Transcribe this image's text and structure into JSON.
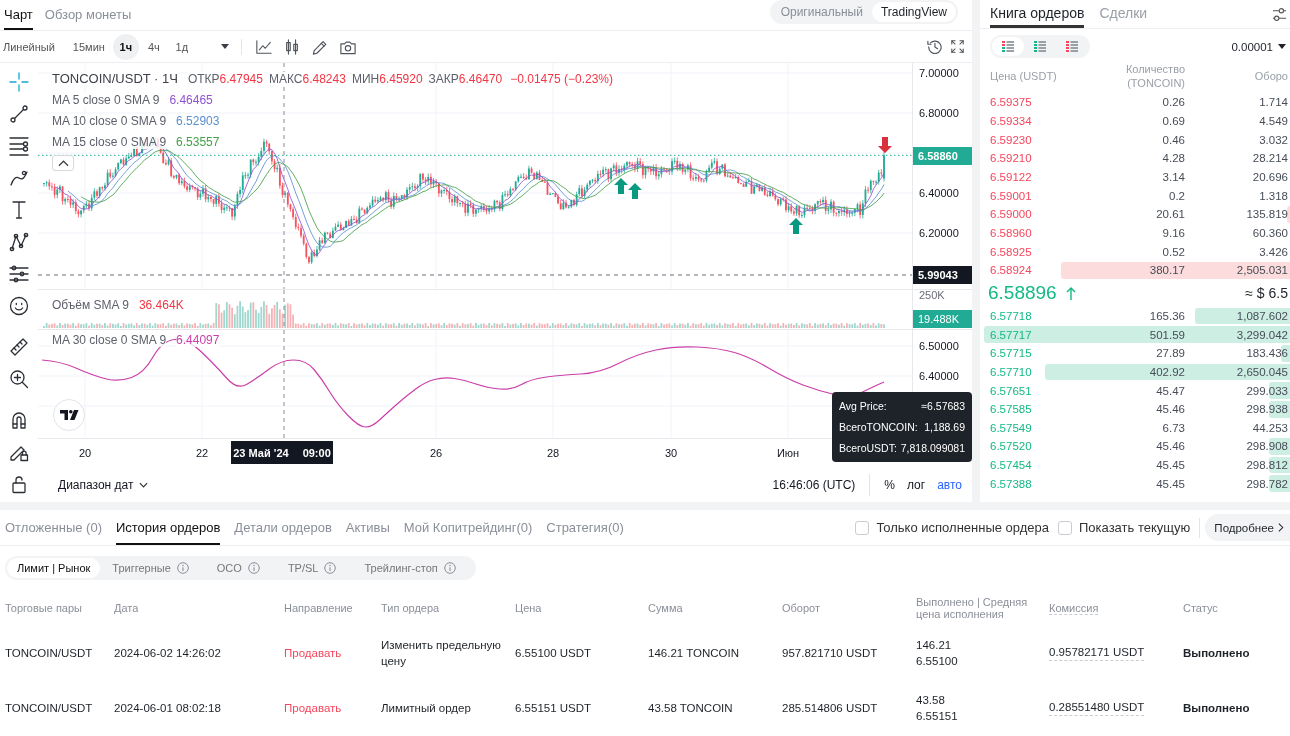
{
  "chart_panel": {
    "tabs": [
      {
        "label": "Чарт",
        "selected": true
      },
      {
        "label": "Обзор монеты",
        "selected": false
      }
    ],
    "view_modes": [
      {
        "label": "Оригинальный",
        "selected": false
      },
      {
        "label": "TradingView",
        "selected": true
      }
    ],
    "intervals": [
      {
        "label": "Линейный",
        "selected": false
      },
      {
        "label": "15мин",
        "selected": false
      },
      {
        "label": "1ч",
        "selected": true
      },
      {
        "label": "4ч",
        "selected": false
      },
      {
        "label": "1д",
        "selected": false
      }
    ],
    "drawing_tools": [
      {
        "kind": "crosshair",
        "selected": true
      },
      {
        "kind": "trendline",
        "selected": false
      },
      {
        "kind": "hlines",
        "selected": false
      },
      {
        "kind": "brush",
        "selected": false
      },
      {
        "kind": "text",
        "selected": false
      },
      {
        "kind": "pattern",
        "selected": false
      },
      {
        "kind": "forecast",
        "selected": false
      },
      {
        "kind": "emoji",
        "selected": false
      },
      {
        "kind": "ruler",
        "selected": false
      },
      {
        "kind": "zoom",
        "selected": false
      },
      {
        "kind": "magnet",
        "selected": false
      },
      {
        "kind": "lockdraw",
        "selected": false
      },
      {
        "kind": "lock",
        "selected": false
      }
    ],
    "legend": {
      "symbol": "TONCOIN/USDT · 1Ч",
      "falling": true,
      "ohlc": [
        {
          "label": "ОТКР",
          "value": "6.47945"
        },
        {
          "label": "МАКС",
          "value": "6.48243"
        },
        {
          "label": "МИН",
          "value": "6.45920"
        },
        {
          "label": "ЗАКР",
          "value": "6.46470"
        }
      ],
      "change": "−0.01475 (−0.23%)",
      "indicators": [
        {
          "name": "MA 5 close 0 SMA 9",
          "value": "6.46465",
          "color": "#9053d1"
        },
        {
          "name": "MA 10 close 0 SMA 9",
          "value": "6.52903",
          "color": "#5b8fd1"
        },
        {
          "name": "MA 15 close 0 SMA 9",
          "value": "6.53557",
          "color": "#43a047"
        }
      ]
    },
    "price_axis": [
      "7.00000",
      "6.80000",
      "6.40000",
      "6.20000"
    ],
    "last_price": "6.58860",
    "crosshair_price": "5.99043",
    "volume": {
      "title": "Объём SMA 9",
      "value": "36.464K",
      "axis": "250K",
      "last": "19.488K"
    },
    "oscillator": {
      "title": "MA 30 close 0 SMA 9",
      "value": "6.44097",
      "color": "#cc3fa8",
      "axis": [
        "6.50000",
        "6.40000"
      ]
    },
    "time_axis": [
      "20",
      "22",
      "26",
      "28",
      "30",
      "Июн"
    ],
    "crosshair_time": {
      "date": "23 Май '24",
      "time": "09:00"
    },
    "tooltip": [
      {
        "label": "Avg Price:",
        "value": "≈6.57683"
      },
      {
        "label": "ВсегоTONCOIN:",
        "value": "1,188.69"
      },
      {
        "label": "ВсегоUSDT:",
        "value": "7,818.099081"
      }
    ],
    "footer": {
      "range": "Диапазон дат",
      "clock": "16:46:06 (UTC)",
      "scale_modes": [
        {
          "label": "%",
          "selected": false
        },
        {
          "label": "лог",
          "selected": false
        },
        {
          "label": "авто",
          "selected": true
        }
      ]
    }
  },
  "order_book": {
    "tabs": [
      {
        "label": "Книга ордеров",
        "selected": true
      },
      {
        "label": "Сделки",
        "selected": false
      }
    ],
    "layouts": [
      {
        "kind": "both",
        "selected": true
      },
      {
        "kind": "bids",
        "selected": false
      },
      {
        "kind": "asks",
        "selected": false
      }
    ],
    "precision": "0.00001",
    "columns": [
      "Цена (USDT)",
      "Количество (TONCOIN)",
      "Оборо"
    ],
    "asks": [
      {
        "price": "6.59375",
        "amount": "0.26",
        "total": "1.714",
        "level": 0
      },
      {
        "price": "6.59334",
        "amount": "0.69",
        "total": "4.549",
        "level": 0
      },
      {
        "price": "6.59230",
        "amount": "0.46",
        "total": "3.032",
        "level": 0
      },
      {
        "price": "6.59210",
        "amount": "4.28",
        "total": "28.214",
        "level": 0
      },
      {
        "price": "6.59122",
        "amount": "3.14",
        "total": "20.696",
        "level": 0
      },
      {
        "price": "6.59001",
        "amount": "0.2",
        "total": "1.318",
        "level": 0
      },
      {
        "price": "6.59000",
        "amount": "20.61",
        "total": "135.819",
        "level": 0.01
      },
      {
        "price": "6.58960",
        "amount": "9.16",
        "total": "60.360",
        "level": 0
      },
      {
        "price": "6.58925",
        "amount": "0.52",
        "total": "3.426",
        "level": 0
      },
      {
        "price": "6.58924",
        "amount": "380.17",
        "total": "2,505.031",
        "level": 0.75
      }
    ],
    "mid": {
      "price": "6.58896",
      "rising": true,
      "usd": "≈ $ 6.5"
    },
    "bids": [
      {
        "price": "6.57718",
        "amount": "165.36",
        "total": "1,087.602",
        "level": 0.31
      },
      {
        "price": "6.57717",
        "amount": "501.59",
        "total": "3,299.042",
        "level": 1
      },
      {
        "price": "6.57715",
        "amount": "27.89",
        "total": "183.436",
        "level": 0.03
      },
      {
        "price": "6.57710",
        "amount": "402.92",
        "total": "2,650.045",
        "level": 0.8
      },
      {
        "price": "6.57651",
        "amount": "45.47",
        "total": "299.033",
        "level": 0.07
      },
      {
        "price": "6.57585",
        "amount": "45.46",
        "total": "298.938",
        "level": 0.07
      },
      {
        "price": "6.57549",
        "amount": "6.73",
        "total": "44.253",
        "level": 0
      },
      {
        "price": "6.57520",
        "amount": "45.46",
        "total": "298.908",
        "level": 0.07
      },
      {
        "price": "6.57454",
        "amount": "45.45",
        "total": "298.812",
        "level": 0.07
      },
      {
        "price": "6.57388",
        "amount": "45.45",
        "total": "298.782",
        "level": 0.07
      }
    ]
  },
  "orders": {
    "tabs": [
      {
        "label": "Отложенные (0)",
        "selected": false
      },
      {
        "label": "История ордеров",
        "selected": true
      },
      {
        "label": "Детали ордеров",
        "selected": false
      },
      {
        "label": "Активы",
        "selected": false
      },
      {
        "label": "Мой Копитрейдинг(0)",
        "selected": false
      },
      {
        "label": "Стратегия(0)",
        "selected": false
      }
    ],
    "filters": [
      {
        "label": "Только исполненные ордера",
        "checked": false
      },
      {
        "label": "Показать текущую",
        "checked": false
      }
    ],
    "more_button": "Подробнее",
    "order_types": [
      {
        "label": "Лимит | Рынок",
        "selected": true,
        "info": false
      },
      {
        "label": "Триггерные",
        "selected": false,
        "info": true
      },
      {
        "label": "OCO",
        "selected": false,
        "info": true
      },
      {
        "label": "TP/SL",
        "selected": false,
        "info": true
      },
      {
        "label": "Трейлинг-стоп",
        "selected": false,
        "info": true
      }
    ],
    "table": {
      "columns": [
        "Торговые пары",
        "Дата",
        "Направление",
        "Тип ордера",
        "Цена",
        "Сумма",
        "Оборот",
        "Выполнено | Средняя цена исполнения",
        "Комиссия",
        "Статус"
      ],
      "rows": [
        {
          "pair": "TONCOIN/USDT",
          "date": "2024-06-02 14:26:02",
          "kind": "sell",
          "direction": "Продавать",
          "type": "Изменить предельную цену",
          "price": "6.55100 USDT",
          "amount": "146.21 TONCOIN",
          "turnover": "957.821710 USDT",
          "filled": "146.21",
          "avg_price": "6.55100",
          "fee": "0.95782171 USDT",
          "status": "Выполнено"
        },
        {
          "pair": "TONCOIN/USDT",
          "date": "2024-06-01 08:02:18",
          "kind": "sell",
          "direction": "Продавать",
          "type": "Лимитный ордер",
          "price": "6.55151 USDT",
          "amount": "43.58 TONCOIN",
          "turnover": "285.514806 USDT",
          "filled": "43.58",
          "avg_price": "6.55151",
          "fee": "0.28551480 USDT",
          "status": "Выполнено"
        }
      ]
    }
  }
}
